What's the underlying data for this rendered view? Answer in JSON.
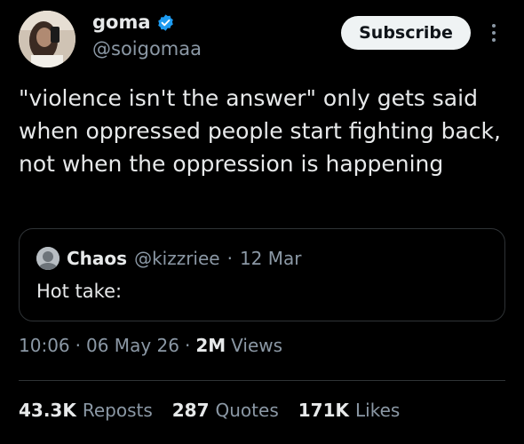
{
  "author": {
    "display_name": "goma",
    "handle": "@soigomaa",
    "verified": true,
    "avatar": "profile-photo"
  },
  "actions": {
    "subscribe_label": "Subscribe",
    "more_icon": "more-vertical-icon"
  },
  "tweet": {
    "text": "\"violence isn't the answer\" only gets said when oppressed people start fighting back, not when the oppression is happening"
  },
  "quote": {
    "author_name": "Chaos",
    "author_handle": "@kizzriee",
    "separator": "·",
    "date": "12 Mar",
    "text": "Hot take:"
  },
  "meta": {
    "time": "10:06",
    "sep1": "·",
    "date": "06 May 26",
    "sep2": "·",
    "views_count": "2M",
    "views_label": "Views"
  },
  "stats": [
    {
      "count": "43.3K",
      "label": "Reposts"
    },
    {
      "count": "287",
      "label": "Quotes"
    },
    {
      "count": "171K",
      "label": "Likes"
    }
  ],
  "colors": {
    "background": "#000000",
    "text_primary": "#e7e9ea",
    "text_secondary": "#8b98a5",
    "verified_blue": "#1d9bf0",
    "border": "#2f3336",
    "subscribe_bg": "#eff3f4"
  }
}
